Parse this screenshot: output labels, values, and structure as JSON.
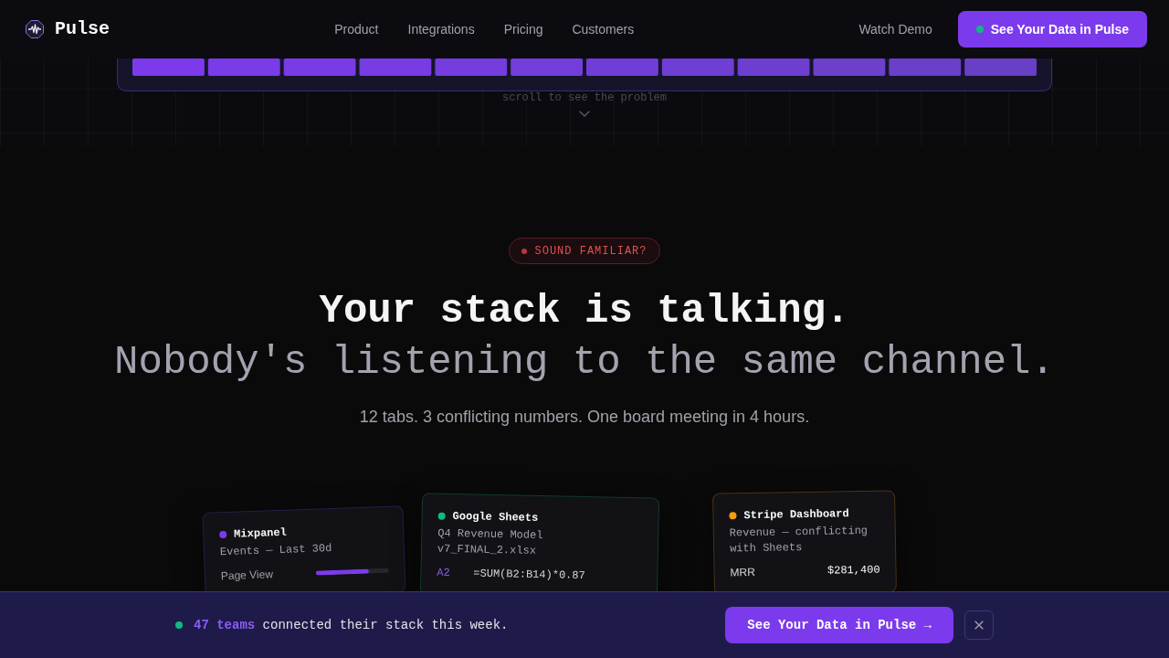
{
  "nav": {
    "brand": "Pulse",
    "links": [
      {
        "label": "Product"
      },
      {
        "label": "Integrations"
      },
      {
        "label": "Pricing"
      },
      {
        "label": "Customers"
      }
    ],
    "secondary_action": "Watch Demo",
    "primary_action": "See Your Data in Pulse"
  },
  "preview_strip": {
    "hint": "scroll to see the problem"
  },
  "hero": {
    "badge": "SOUND FAMILIAR?",
    "headline": "Your stack is talking.",
    "headline_muted": "Nobody's listening to the same channel.",
    "subtitle": "12 tabs. 3 conflicting numbers. One board meeting in 4 hours.",
    "source_cards": [
      {
        "kind": "meter",
        "title": "Mixpanel",
        "color": "#7c3aed",
        "subtitle": "Events — Last 30d",
        "row": {
          "label": "Page View",
          "level": 0.72
        }
      },
      {
        "kind": "formula",
        "title": "Google Sheets",
        "color": "#10b981",
        "subtitle": "Q4 Revenue Model v7_FINAL_2.xlsx",
        "row": {
          "label": "A2",
          "value": "=SUM(B2:B14)*0.87"
        }
      },
      {
        "kind": "metric",
        "title": "Stripe Dashboard",
        "color": "#f59e0b",
        "subtitle": "Revenue — conflicting with Sheets",
        "row": {
          "label": "MRR",
          "value": "$281,400"
        }
      }
    ]
  },
  "signup_bar": {
    "message": "**47 teams** connected their stack this week.",
    "button": "See Your Data in Pulse →"
  }
}
